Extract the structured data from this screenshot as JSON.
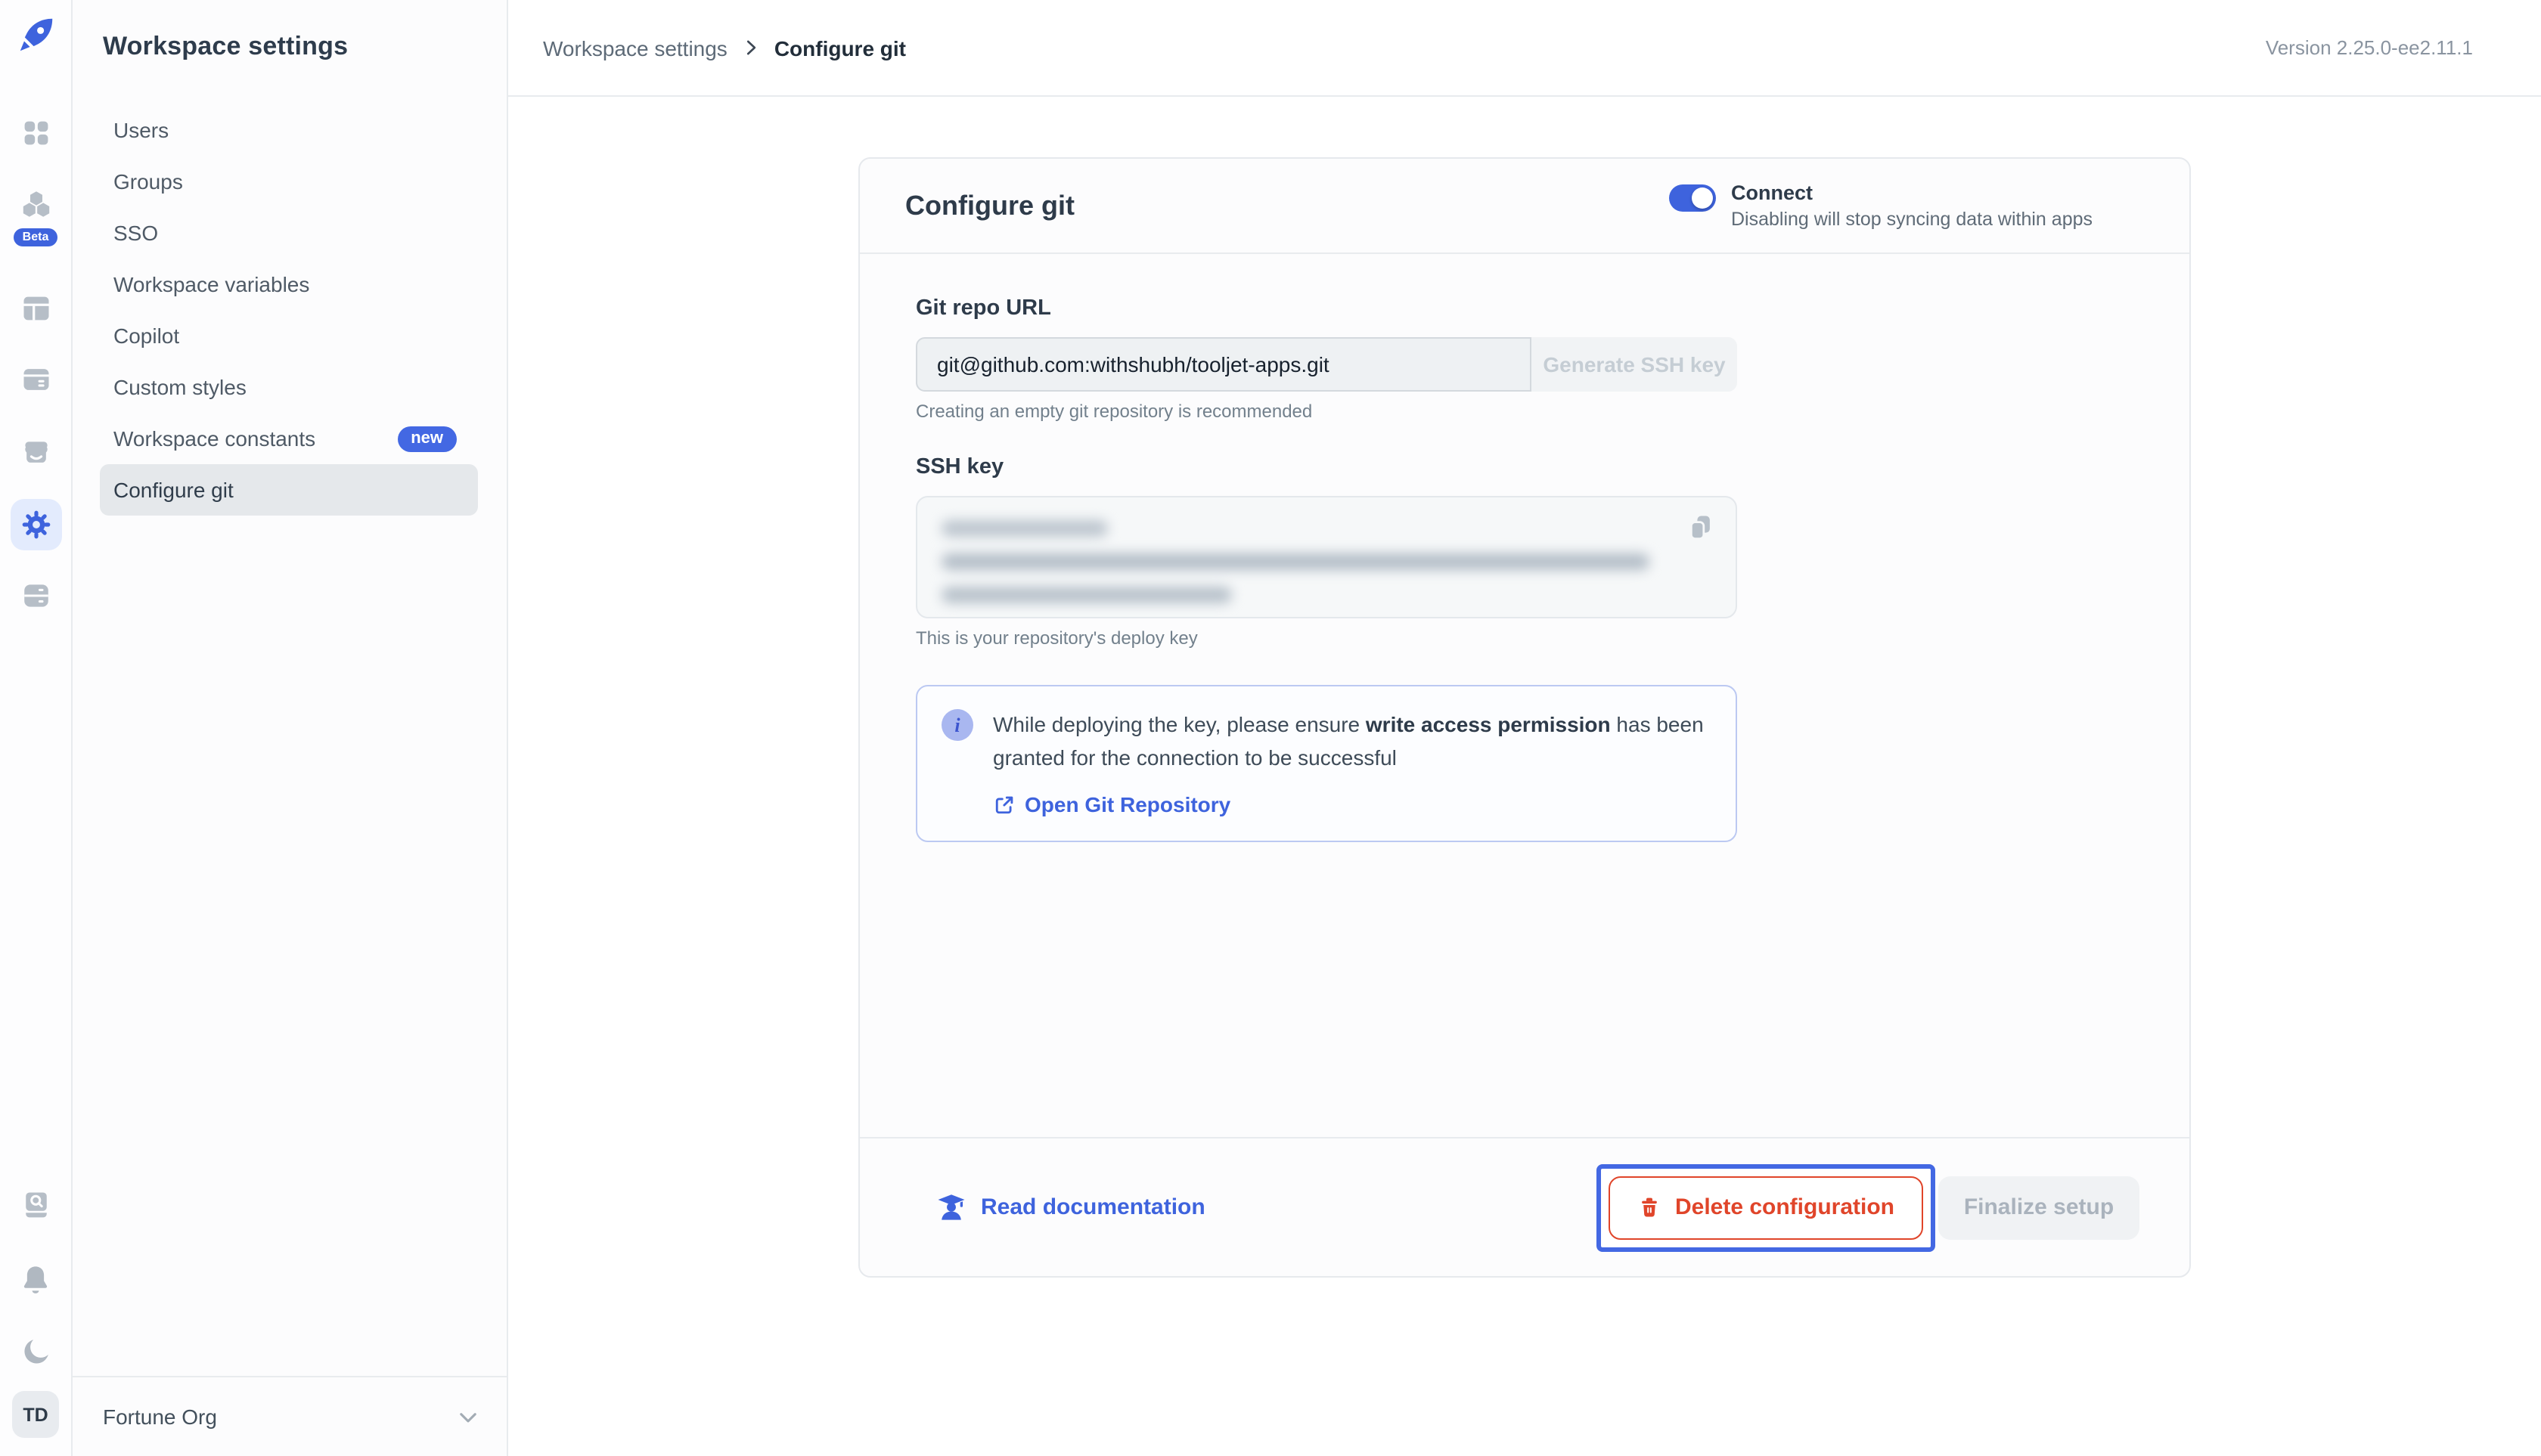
{
  "rail": {
    "beta_badge": "Beta",
    "avatar_initials": "TD"
  },
  "sidebar": {
    "title": "Workspace settings",
    "items": [
      {
        "label": "Users"
      },
      {
        "label": "Groups"
      },
      {
        "label": "SSO"
      },
      {
        "label": "Workspace variables"
      },
      {
        "label": "Copilot"
      },
      {
        "label": "Custom styles"
      },
      {
        "label": "Workspace constants",
        "badge": "new"
      },
      {
        "label": "Configure git",
        "active": true
      }
    ],
    "org_name": "Fortune Org"
  },
  "topbar": {
    "breadcrumb_parent": "Workspace settings",
    "breadcrumb_current": "Configure git",
    "version": "Version 2.25.0-ee2.11.1"
  },
  "card": {
    "title": "Configure git",
    "connect_toggle": {
      "label": "Connect",
      "description": "Disabling will stop syncing data within apps",
      "state": "on"
    },
    "git_repo_url": {
      "label": "Git repo URL",
      "value": "git@github.com:withshubh/tooljet-apps.git",
      "generate_button_label": "Generate SSH key",
      "helper": "Creating an empty git repository is recommended"
    },
    "ssh_key": {
      "label": "SSH key",
      "helper": "This is your repository's deploy key"
    },
    "info_alert": {
      "text_before_bold": "While deploying the key, please ensure ",
      "bold_text": "write access permission",
      "text_after_bold": " has been granted for the connection to be successful",
      "link_label": "Open Git Repository"
    },
    "footer": {
      "docs_link_label": "Read documentation",
      "delete_button_label": "Delete configuration",
      "finalize_button_label": "Finalize setup"
    }
  },
  "colors": {
    "accent_blue": "#3E63DD",
    "danger_red": "#E0452A",
    "active_nav_bg": "#E5E8EB"
  }
}
